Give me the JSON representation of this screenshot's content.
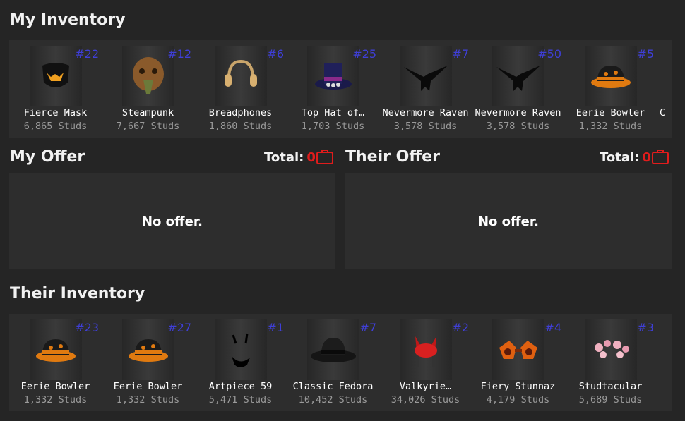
{
  "my_inventory": {
    "title": "My Inventory",
    "items": [
      {
        "name": "Fierce Mask",
        "price": "6,865 Studs",
        "serial": "#22",
        "icon": "fierce-mask-icon"
      },
      {
        "name": "Steampunk",
        "price": "7,667 Studs",
        "serial": "#12",
        "icon": "steampunk-mask-icon"
      },
      {
        "name": "Breadphones",
        "price": "1,860 Studs",
        "serial": "#6",
        "icon": "headphones-icon"
      },
      {
        "name": "Top Hat of…",
        "price": "1,703 Studs",
        "serial": "#25",
        "icon": "top-hat-icon"
      },
      {
        "name": "Nevermore Raven",
        "price": "3,578 Studs",
        "serial": "#7",
        "icon": "raven-icon"
      },
      {
        "name": "Nevermore Raven",
        "price": "3,578 Studs",
        "serial": "#50",
        "icon": "raven-icon"
      },
      {
        "name": "Eerie Bowler",
        "price": "1,332 Studs",
        "serial": "#5",
        "icon": "bowler-hat-icon"
      },
      {
        "name": "C",
        "price": "",
        "serial": "",
        "icon": ""
      }
    ]
  },
  "my_offer": {
    "title": "My Offer",
    "total_label": "Total:",
    "total_value": "0",
    "empty_text": "No offer."
  },
  "their_offer": {
    "title": "Their Offer",
    "total_label": "Total:",
    "total_value": "0",
    "empty_text": "No offer."
  },
  "their_inventory": {
    "title": "Their Inventory",
    "items": [
      {
        "name": "Eerie Bowler",
        "price": "1,332 Studs",
        "serial": "#23",
        "icon": "bowler-hat-icon"
      },
      {
        "name": "Eerie Bowler",
        "price": "1,332 Studs",
        "serial": "#27",
        "icon": "bowler-hat-icon"
      },
      {
        "name": "Artpiece 59",
        "price": "5,471 Studs",
        "serial": "#1",
        "icon": "face-icon"
      },
      {
        "name": "Classic Fedora",
        "price": "10,452 Studs",
        "serial": "#7",
        "icon": "fedora-icon"
      },
      {
        "name": "Valkyrie…",
        "price": "34,026 Studs",
        "serial": "#2",
        "icon": "valkyrie-helm-icon"
      },
      {
        "name": "Fiery Stunnaz",
        "price": "4,179 Studs",
        "serial": "#4",
        "icon": "sunglasses-icon"
      },
      {
        "name": "Studtacular",
        "price": "5,689 Studs",
        "serial": "#3",
        "icon": "flowers-icon"
      }
    ]
  },
  "colors": {
    "background": "#252525",
    "panel": "#2d2d2d",
    "serial": "#3f3fd8",
    "total_accent": "#e01c1c",
    "price_text": "#9a9a9a"
  }
}
